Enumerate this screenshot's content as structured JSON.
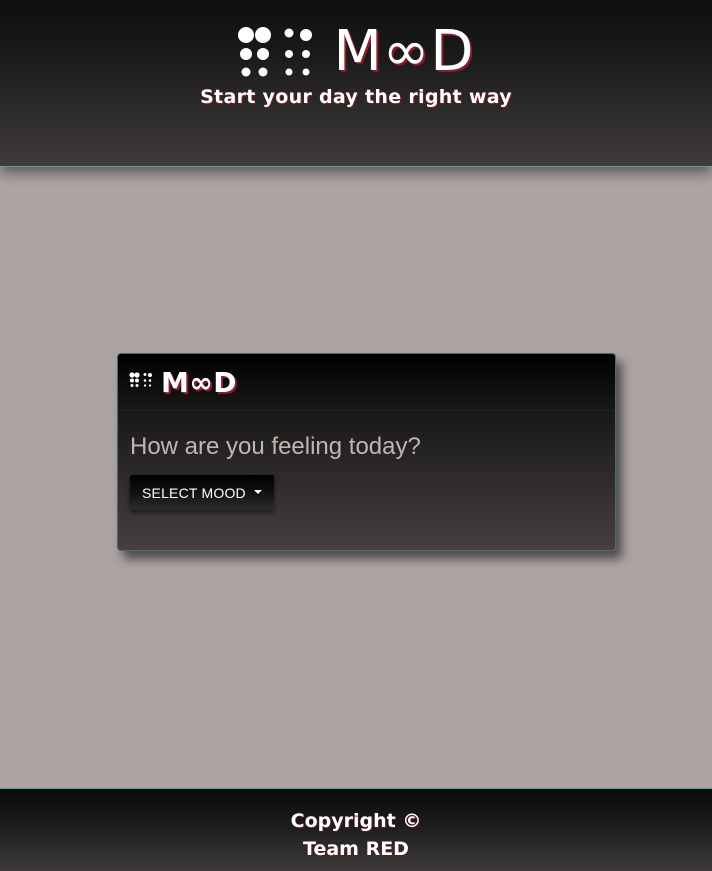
{
  "header": {
    "logo_text": "M∞D",
    "tagline": "Start your day the right way"
  },
  "card": {
    "logo_text": "M∞D",
    "question": "How are you feeling today?",
    "select_button_label": "SELECT MOOD"
  },
  "footer": {
    "copyright_line": "Copyright ©",
    "team_line": "Team RED"
  },
  "colors": {
    "accent_border": "#4aa7a3",
    "page_background": "#aca3a3",
    "logo_shadow": "#8c1b2a"
  },
  "icons": {
    "logo_mark": "braille-dots-icon",
    "dropdown": "caret-down-icon"
  }
}
